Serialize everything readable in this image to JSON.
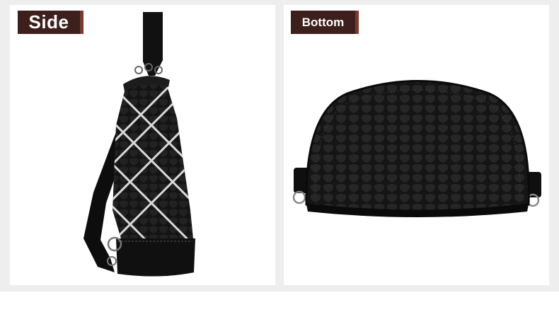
{
  "panels": {
    "side": {
      "label": "Side"
    },
    "bottom": {
      "label": "Bottom"
    }
  },
  "colors": {
    "background": "#eeeeee",
    "panel": "#ffffff",
    "label_bg": "#3d1f1c",
    "label_accent": "#7a3a33",
    "leather": "#141414",
    "stitch": "#d9d9d9"
  },
  "icons": [
    "bag-side-image",
    "bag-bottom-image"
  ]
}
